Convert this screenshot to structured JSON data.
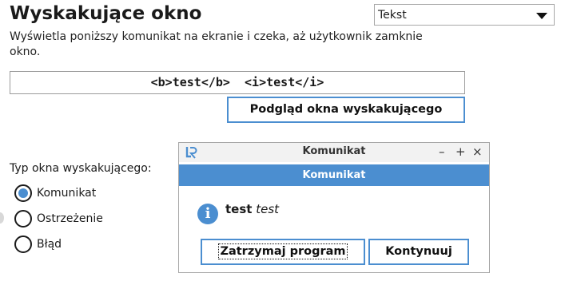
{
  "header": {
    "title": "Wyskakujące okno",
    "description": "Wyświetla poniższy komunikat na ekranie i czeka, aż użytkownik zamknie okno."
  },
  "format_select": {
    "selected": "Tekst"
  },
  "message_field": {
    "value": "<b>test</b>  <i>test</i>"
  },
  "preview_button": {
    "label": "Podgląd okna wyskakującego"
  },
  "popup_type": {
    "label": "Typ okna wyskakującego:",
    "options": [
      "Komunikat",
      "Ostrzeżenie",
      "Błąd"
    ],
    "selected_index": 0
  },
  "dialog": {
    "window_title": "Komunikat",
    "window_controls": {
      "minimize": "–",
      "maximize": "+",
      "close": "×"
    },
    "logo_icon": "lr-logo",
    "header": "Komunikat",
    "info_icon_glyph": "i",
    "message_bold": "test",
    "message_italic": "test",
    "stop_button": "Zatrzymaj program",
    "continue_button": "Kontynuuj"
  },
  "colors": {
    "accent": "#4b8ed0"
  }
}
